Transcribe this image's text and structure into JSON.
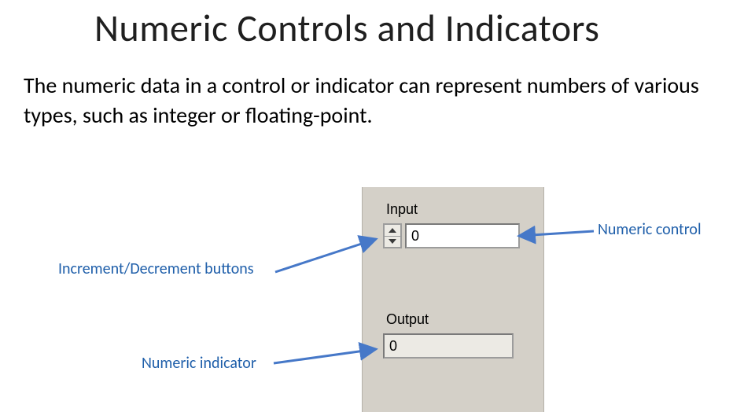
{
  "title": "Numeric Controls and Indicators",
  "body_text": "The numeric data in a control or indicator can represent numbers of various types, such as integer or floating-point.",
  "panel": {
    "input_label": "Input",
    "output_label": "Output",
    "control_value": "0",
    "indicator_value": "0"
  },
  "callouts": {
    "increment_decrement": "Increment/Decrement buttons",
    "numeric_control": "Numeric control",
    "numeric_indicator": "Numeric indicator"
  },
  "colors": {
    "callout_blue": "#1f5faa",
    "panel_gray": "#d4d0c8"
  }
}
